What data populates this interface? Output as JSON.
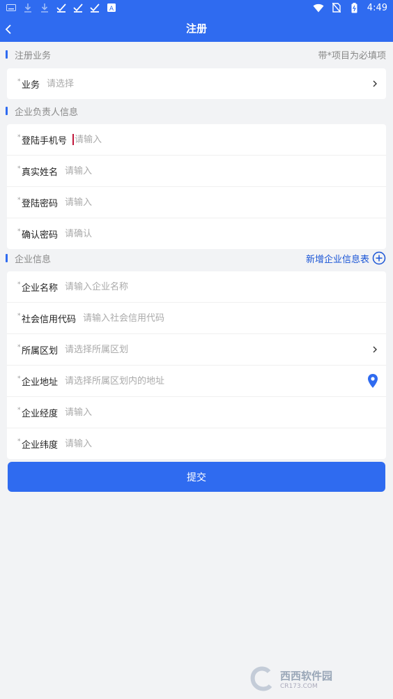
{
  "status": {
    "time": "4:49",
    "letter": "A"
  },
  "appbar": {
    "title": "注册"
  },
  "sections": {
    "business": {
      "title": "注册业务",
      "note": "带*项目为必填项"
    },
    "leader": {
      "title": "企业负责人信息"
    },
    "company": {
      "title": "企业信息",
      "add_label": "新增企业信息表"
    }
  },
  "business_rows": [
    {
      "label": "业务",
      "placeholder": "请选择"
    }
  ],
  "leader_rows": [
    {
      "label": "登陆手机号",
      "placeholder": "请输入"
    },
    {
      "label": "真实姓名",
      "placeholder": "请输入"
    },
    {
      "label": "登陆密码",
      "placeholder": "请输入"
    },
    {
      "label": "确认密码",
      "placeholder": "请确认"
    }
  ],
  "company_rows": [
    {
      "label": "企业名称",
      "placeholder": "请输入企业名称"
    },
    {
      "label": "社会信用代码",
      "placeholder": "请输入社会信用代码"
    },
    {
      "label": "所属区划",
      "placeholder": "请选择所属区划"
    },
    {
      "label": "企业地址",
      "placeholder": "请选择所属区划内的地址"
    },
    {
      "label": "企业经度",
      "placeholder": "请输入"
    },
    {
      "label": "企业纬度",
      "placeholder": "请输入"
    }
  ],
  "submit_label": "提交",
  "required_mark": "*",
  "watermark": {
    "text": "西西软件园",
    "sub": "CR173.COM"
  },
  "colors": {
    "primary": "#2f6bf0",
    "link": "#1a55d6",
    "background": "#f2f3f5"
  }
}
